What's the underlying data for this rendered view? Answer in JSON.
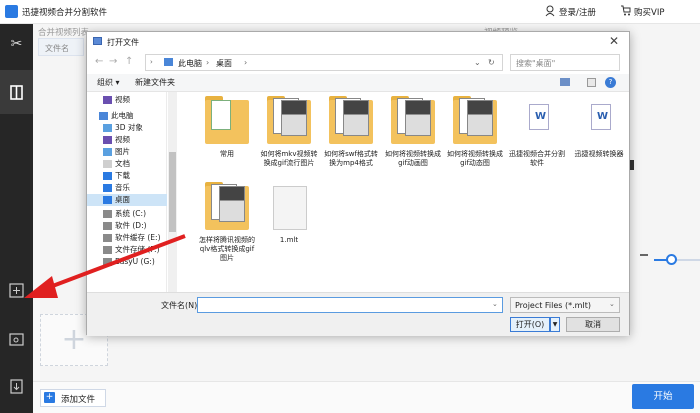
{
  "app": {
    "title": "迅捷视频合并分割软件",
    "login": "登录/注册",
    "vip": "购买VIP",
    "accent": "#2a7ae2"
  },
  "main": {
    "merge_list_title": "合并视频列表",
    "col_filename": "文件名",
    "preview_title": "视频预览",
    "add_file": "添加文件",
    "start": "开始"
  },
  "dialog": {
    "title": "打开文件",
    "path": [
      "此电脑",
      "桌面"
    ],
    "search_placeholder": "搜索\"桌面\"",
    "organize": "组织 ▾",
    "new_folder": "新建文件夹",
    "nav_items": [
      {
        "label": "视频",
        "icon": "video-icon"
      },
      {
        "label": "此电脑",
        "icon": "computer-icon"
      },
      {
        "label": "3D 对象",
        "icon": "3d-icon"
      },
      {
        "label": "视频",
        "icon": "video-icon"
      },
      {
        "label": "图片",
        "icon": "picture-icon"
      },
      {
        "label": "文档",
        "icon": "document-icon"
      },
      {
        "label": "下载",
        "icon": "download-icon"
      },
      {
        "label": "音乐",
        "icon": "music-icon"
      },
      {
        "label": "桌面",
        "icon": "desktop-icon"
      },
      {
        "label": "系统 (C:)",
        "icon": "drive-icon"
      },
      {
        "label": "软件 (D:)",
        "icon": "drive-icon"
      },
      {
        "label": "软件缓存 (E:)",
        "icon": "drive-icon"
      },
      {
        "label": "文件存储 (F:)",
        "icon": "drive-icon"
      },
      {
        "label": "EasyU (G:)",
        "icon": "drive-icon"
      }
    ],
    "files": [
      {
        "label": "常用",
        "kind": "folder"
      },
      {
        "label": "如何将mkv视频转换成gif流行图片",
        "kind": "folder-doc"
      },
      {
        "label": "如何将swf格式转换为mp4格式",
        "kind": "folder-doc"
      },
      {
        "label": "如何将视频转换成gif动画图",
        "kind": "folder-doc"
      },
      {
        "label": "如何将视频转换成gif动态图",
        "kind": "folder-doc"
      },
      {
        "label": "迅捷视频合并分割软件",
        "kind": "word"
      },
      {
        "label": "迅捷视频转换器",
        "kind": "word"
      },
      {
        "label": "怎样将腾讯视频的qlv格式转换成gif图片",
        "kind": "folder-doc"
      },
      {
        "label": "1.mlt",
        "kind": "blank"
      }
    ],
    "filename_label": "文件名(N):",
    "filename_value": "",
    "filetype": "Project Files (*.mlt)",
    "open": "打开(O)",
    "cancel": "取消"
  }
}
